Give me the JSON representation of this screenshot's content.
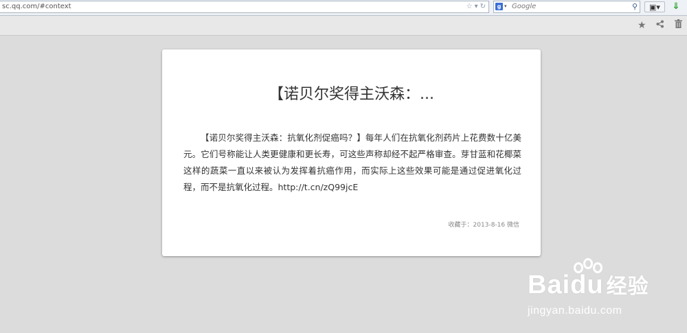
{
  "browser": {
    "url": "sc.qq.com/#context",
    "search_placeholder": "Google",
    "search_engine_badge": "g",
    "icons": {
      "url_star": "star-outline-icon",
      "url_dropdown": "chevron-down-icon",
      "reload": "reload-icon",
      "search_go": "magnifier-icon",
      "bookmarks": "bookmarks-icon",
      "download": "download-arrow-icon"
    }
  },
  "toolbar": {
    "icons": [
      "star-icon",
      "share-icon",
      "trash-icon"
    ]
  },
  "card": {
    "title": "【诺贝尔奖得主沃森：...",
    "body": "【诺贝尔奖得主沃森：抗氧化剂促癌吗？】每年人们在抗氧化剂药片上花费数十亿美元。它们号称能让人类更健康和更长寿，可这些声称却经不起严格审查。芽甘蓝和花椰菜这样的蔬菜一直以来被认为发挥着抗癌作用，而实际上这些效果可能是通过促进氧化过程，而不是抗氧化过程。http://t.cn/zQ99jcE",
    "meta": "收藏于：2013-8-16 微信"
  },
  "watermark": {
    "brand": "Bai",
    "brand_du": "du",
    "brand_cn": "经验",
    "url": "jingyan.baidu.com"
  }
}
